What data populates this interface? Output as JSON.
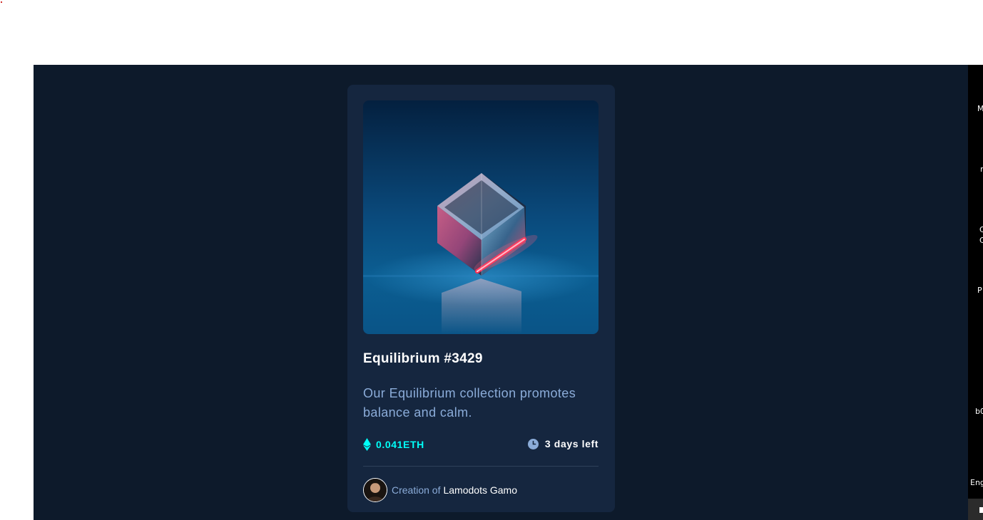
{
  "card": {
    "image_alt": "Equilibrium",
    "title": "Equilibrium #3429",
    "description": "Our Equilibrium collection promotes balance and calm.",
    "price": "0.041ETH",
    "time_left": "3 days left",
    "creator_label": "Creation of",
    "creator_name": "Lamodots Gamo"
  },
  "icons": {
    "price": "ethereum-icon",
    "time": "clock-icon"
  },
  "side_panel": {
    "fragments": [
      "M",
      "n",
      "C",
      "C",
      "P",
      "b0",
      "Eng"
    ]
  },
  "colors": {
    "page_background": "#0d1a2b",
    "card_background": "#15263f",
    "cyan_accent": "#00fff8",
    "soft_blue": "#8bacd9",
    "divider": "#2e405a",
    "white": "#ffffff"
  }
}
